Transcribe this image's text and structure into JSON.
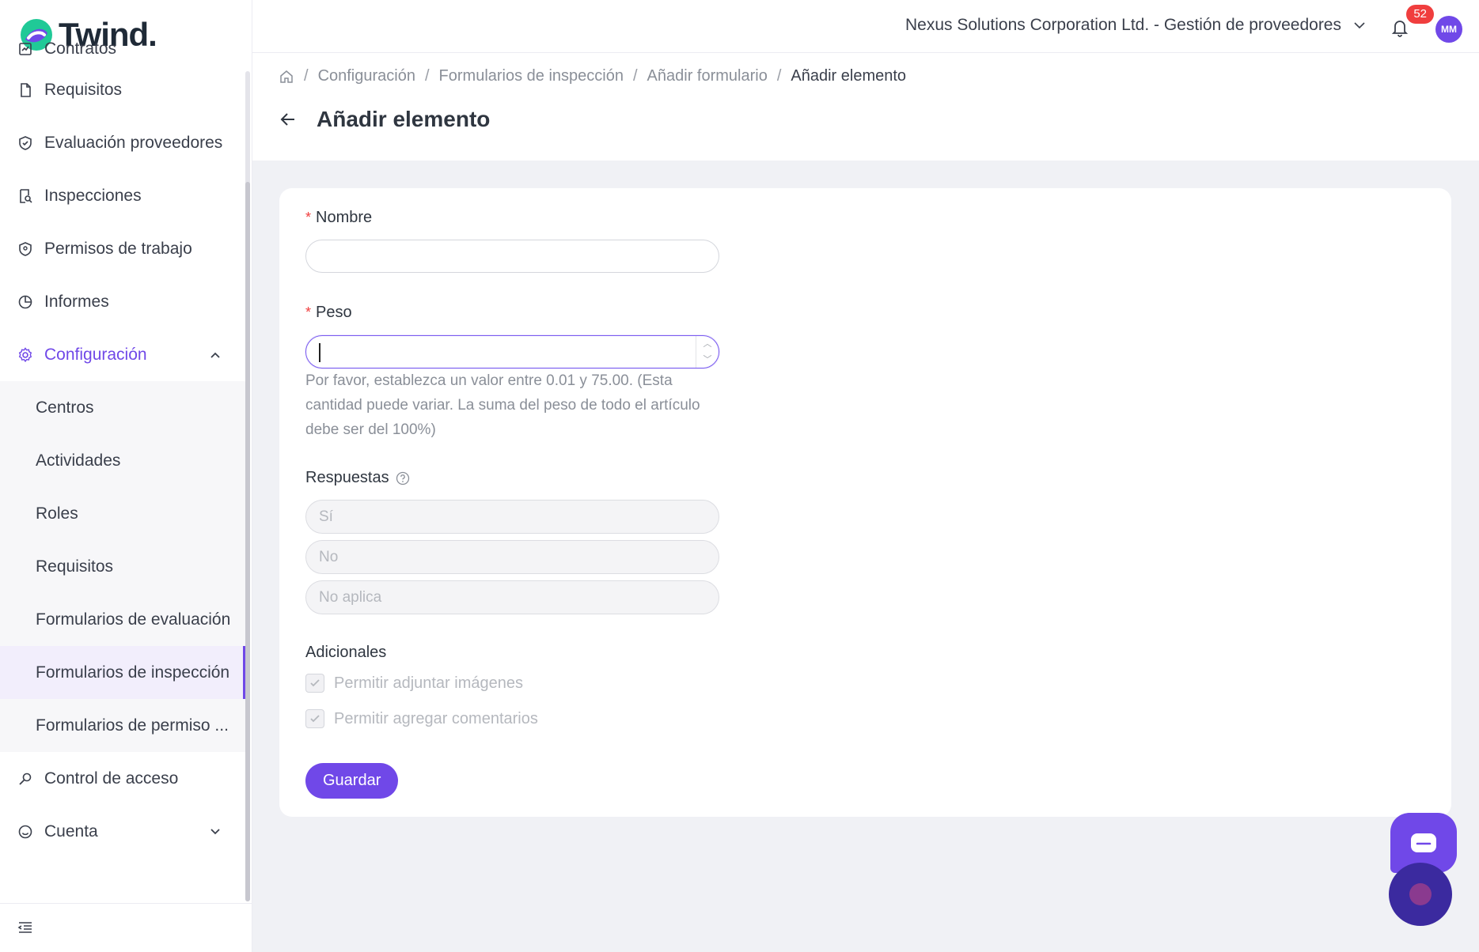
{
  "app": {
    "logo_text": "Twind."
  },
  "sidebar": {
    "items": [
      {
        "label": "Contratos",
        "icon": "contract-icon"
      },
      {
        "label": "Requisitos",
        "icon": "document-icon"
      },
      {
        "label": "Evaluación proveedores",
        "icon": "shield-check-icon"
      },
      {
        "label": "Inspecciones",
        "icon": "inspection-icon"
      },
      {
        "label": "Permisos de trabajo",
        "icon": "shield-icon"
      },
      {
        "label": "Informes",
        "icon": "pie-chart-icon"
      },
      {
        "label": "Configuración",
        "icon": "gear-icon",
        "expanded": true
      },
      {
        "label": "Control de acceso",
        "icon": "key-icon"
      },
      {
        "label": "Cuenta",
        "icon": "smile-icon",
        "expanded": false
      }
    ],
    "config_sub_items": [
      {
        "label": "Centros"
      },
      {
        "label": "Actividades"
      },
      {
        "label": "Roles"
      },
      {
        "label": "Requisitos"
      },
      {
        "label": "Formularios de evaluación"
      },
      {
        "label": "Formularios de inspección",
        "selected": true
      },
      {
        "label": "Formularios de permiso ..."
      }
    ]
  },
  "topbar": {
    "organization": "Nexus Solutions Corporation Ltd. - Gestión de proveedores",
    "notifications_count": "52",
    "avatar_initials": "MM"
  },
  "breadcrumb": {
    "items": [
      "Configuración",
      "Formularios de inspección",
      "Añadir formulario"
    ],
    "current": "Añadir elemento"
  },
  "page": {
    "title": "Añadir elemento"
  },
  "form": {
    "name_label": "Nombre",
    "name_value": "",
    "weight_label": "Peso",
    "weight_value": "",
    "weight_help": "Por favor, establezca un valor entre 0.01 y 75.00. (Esta cantidad puede variar. La suma del peso de todo el artículo debe ser del 100%)",
    "answers_label": "Respuestas",
    "answers": [
      "Sí",
      "No",
      "No aplica"
    ],
    "additional_label": "Adicionales",
    "options": [
      {
        "label": "Permitir adjuntar imágenes",
        "checked": true
      },
      {
        "label": "Permitir agregar comentarios",
        "checked": true
      }
    ],
    "save_label": "Guardar"
  },
  "colors": {
    "accent": "#7048e8",
    "badge": "#f03e3e",
    "required": "#f03e3e"
  }
}
